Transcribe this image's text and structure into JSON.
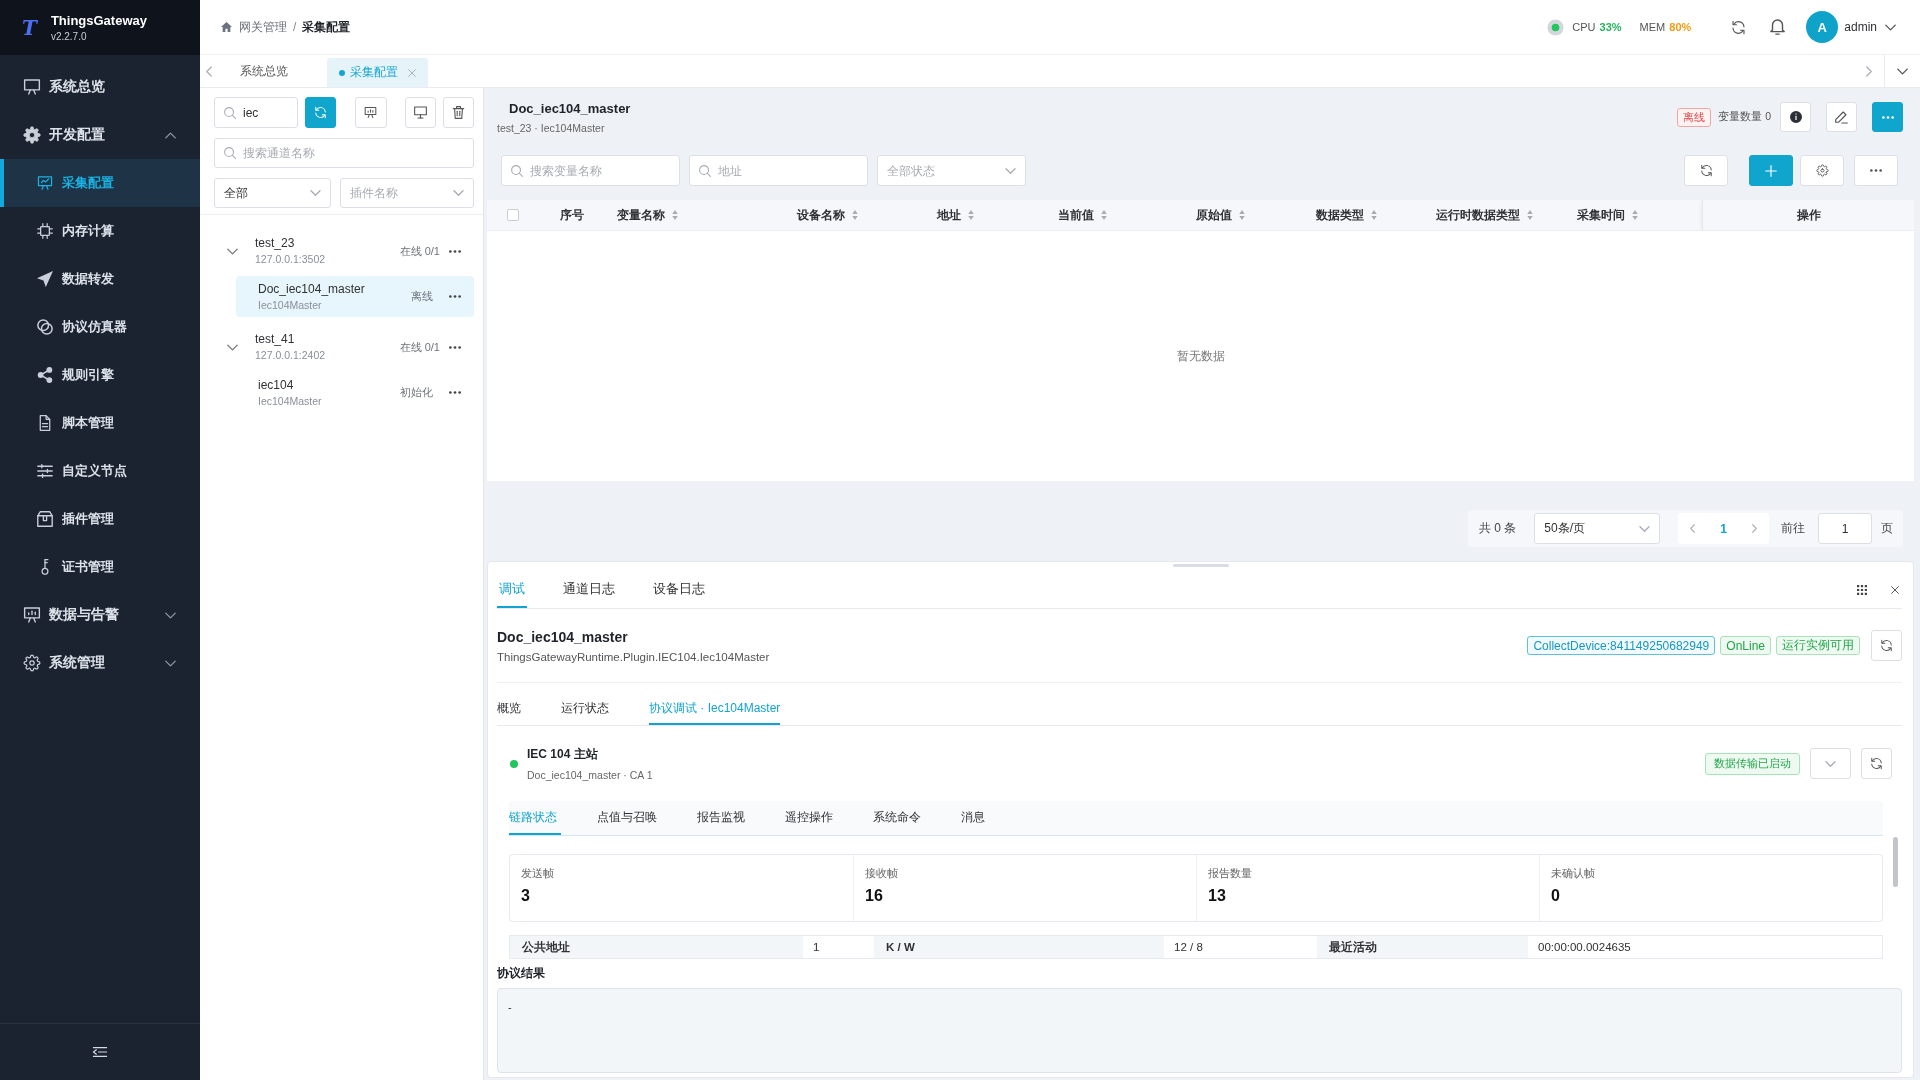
{
  "brand": {
    "logo": "T",
    "name": "ThingsGateway",
    "version": "v2.2.7.0"
  },
  "sidebar": {
    "items": [
      {
        "label": "系统总览",
        "kind": "link",
        "selected": false
      },
      {
        "label": "开发配置",
        "kind": "group",
        "selected": false,
        "expanded": true,
        "children": [
          {
            "label": "采集配置",
            "selected": true
          },
          {
            "label": "内存计算",
            "selected": false
          },
          {
            "label": "数据转发",
            "selected": false
          },
          {
            "label": "协议仿真器",
            "selected": false
          },
          {
            "label": "规则引擎",
            "selected": false
          },
          {
            "label": "脚本管理",
            "selected": false
          },
          {
            "label": "自定义节点",
            "selected": false
          },
          {
            "label": "插件管理",
            "selected": false
          },
          {
            "label": "证书管理",
            "selected": false
          }
        ]
      },
      {
        "label": "数据与告警",
        "kind": "group",
        "selected": false,
        "expanded": false
      },
      {
        "label": "系统管理",
        "kind": "group",
        "selected": false,
        "expanded": false
      }
    ]
  },
  "header": {
    "breadcrumb": [
      {
        "label": "网关管理",
        "current": false
      },
      {
        "label": "采集配置",
        "current": true
      }
    ],
    "separator": "/",
    "metrics": [
      {
        "label": "CPU",
        "value": "33%",
        "color": "#22b35e"
      },
      {
        "label": "MEM",
        "value": "80%",
        "color": "#f29b11"
      }
    ],
    "user": {
      "initial": "A",
      "name": "admin"
    }
  },
  "tabs": [
    {
      "label": "系统总览",
      "selected": false,
      "closable": false
    },
    {
      "label": "采集配置",
      "selected": true,
      "closable": true
    }
  ],
  "channel_panel": {
    "search": {
      "value": "iec"
    },
    "channel_search": {
      "placeholder": "搜索通道名称"
    },
    "type_select": {
      "value": "全部"
    },
    "plugin_select": {
      "placeholder": "插件名称"
    },
    "channels": [
      {
        "name": "test_23",
        "address": "127.0.0.1:3502",
        "status": "在线 0/1",
        "expanded": true,
        "children": [
          {
            "name": "Doc_iec104_master",
            "plugin": "Iec104Master",
            "status": "离线",
            "selected": true
          }
        ]
      },
      {
        "name": "test_41",
        "address": "127.0.0.1:2402",
        "status": "在线 0/1",
        "expanded": true,
        "children": [
          {
            "name": "iec104",
            "plugin": "Iec104Master",
            "status": "初始化",
            "selected": false
          }
        ]
      }
    ]
  },
  "device_panel": {
    "title": "Doc_iec104_master",
    "subtitle": "test_23 · Iec104Master",
    "status": {
      "text": "离线",
      "kind": "danger"
    },
    "variable_count": "变量数量 0",
    "filters": {
      "name": {
        "placeholder": "搜索变量名称"
      },
      "address": {
        "placeholder": "地址"
      },
      "state": {
        "placeholder": "全部状态"
      }
    },
    "table": {
      "select_all": {
        "checked": false
      },
      "columns": [
        {
          "label": "序号",
          "sortable": false
        },
        {
          "label": "变量名称",
          "sortable": true
        },
        {
          "label": "设备名称",
          "sortable": true
        },
        {
          "label": "地址",
          "sortable": true
        },
        {
          "label": "当前值",
          "sortable": true
        },
        {
          "label": "原始值",
          "sortable": true
        },
        {
          "label": "数据类型",
          "sortable": true
        },
        {
          "label": "运行时数据类型",
          "sortable": true
        },
        {
          "label": "采集时间",
          "sortable": true
        },
        {
          "label": "操作",
          "sortable": false
        }
      ],
      "empty_text": "暂无数据"
    },
    "pagination": {
      "total": "共 0 条",
      "page_size": "50条/页",
      "pages": [
        {
          "label": "1",
          "selected": true
        }
      ],
      "goto_label": "前往",
      "goto_value": "1",
      "goto_suffix": "页"
    }
  },
  "debug_panel": {
    "tabs": [
      {
        "label": "调试",
        "selected": true
      },
      {
        "label": "通道日志",
        "selected": false
      },
      {
        "label": "设备日志",
        "selected": false
      }
    ],
    "title": "Doc_iec104_master",
    "subtitle": "ThingsGatewayRuntime.Plugin.IEC104.Iec104Master",
    "tags": [
      {
        "text": "CollectDevice:841149250682949",
        "kind": "info"
      },
      {
        "text": "OnLine",
        "kind": "success"
      },
      {
        "text": "运行实例可用",
        "kind": "success"
      }
    ],
    "sub_tabs": [
      {
        "label": "概览",
        "selected": false
      },
      {
        "label": "运行状态",
        "selected": false
      },
      {
        "label": "协议调试 · Iec104Master",
        "selected": true
      }
    ],
    "station": {
      "title": "IEC 104 主站",
      "subtitle": "Doc_iec104_master · CA 1",
      "connected": true,
      "badge": "数据传输已启动"
    },
    "inner_tabs": [
      {
        "label": "链路状态",
        "selected": true
      },
      {
        "label": "点值与召唤",
        "selected": false
      },
      {
        "label": "报告监视",
        "selected": false
      },
      {
        "label": "遥控操作",
        "selected": false
      },
      {
        "label": "系统命令",
        "selected": false
      },
      {
        "label": "消息",
        "selected": false
      }
    ],
    "stats": [
      {
        "label": "发送帧",
        "value": "3"
      },
      {
        "label": "接收帧",
        "value": "16"
      },
      {
        "label": "报告数量",
        "value": "13"
      },
      {
        "label": "未确认帧",
        "value": "0"
      }
    ],
    "info_row": [
      {
        "label": "公共地址",
        "value": "1"
      },
      {
        "label": "K / W",
        "value": "12 / 8"
      },
      {
        "label": "最近活动",
        "value": "00:00:00.0024635"
      }
    ],
    "result": {
      "label": "协议结果",
      "value": "-"
    }
  }
}
